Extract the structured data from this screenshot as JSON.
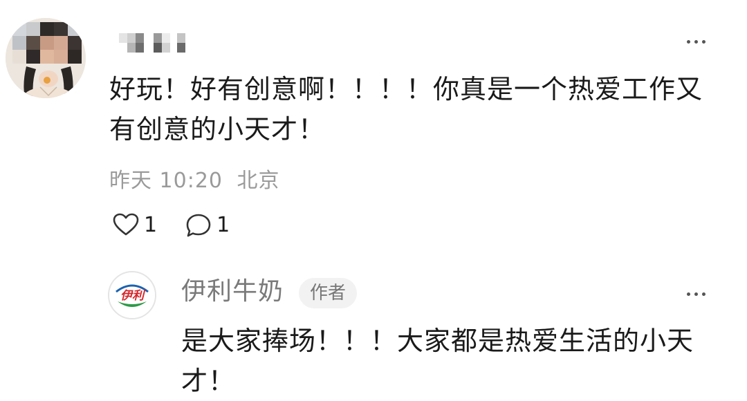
{
  "comment": {
    "text": "好玩！好有创意啊！！！！你真是一个热爱工作又有创意的小天才！",
    "date": "昨天 10:20",
    "location": "北京",
    "likes": "1",
    "replies": "1",
    "icons": {
      "like": "heart-outline-icon",
      "reply": "speech-bubble-icon",
      "more": "more-dots-icon"
    }
  },
  "reply": {
    "author": "伊利牛奶",
    "badge": "作者",
    "text": "是大家捧场！！！大家都是热爱生活的小天才！",
    "logo_text": "伊利",
    "colors": {
      "logo_red": "#d6262b",
      "logo_green": "#2e9a48",
      "logo_blue": "#1a62b0"
    }
  }
}
